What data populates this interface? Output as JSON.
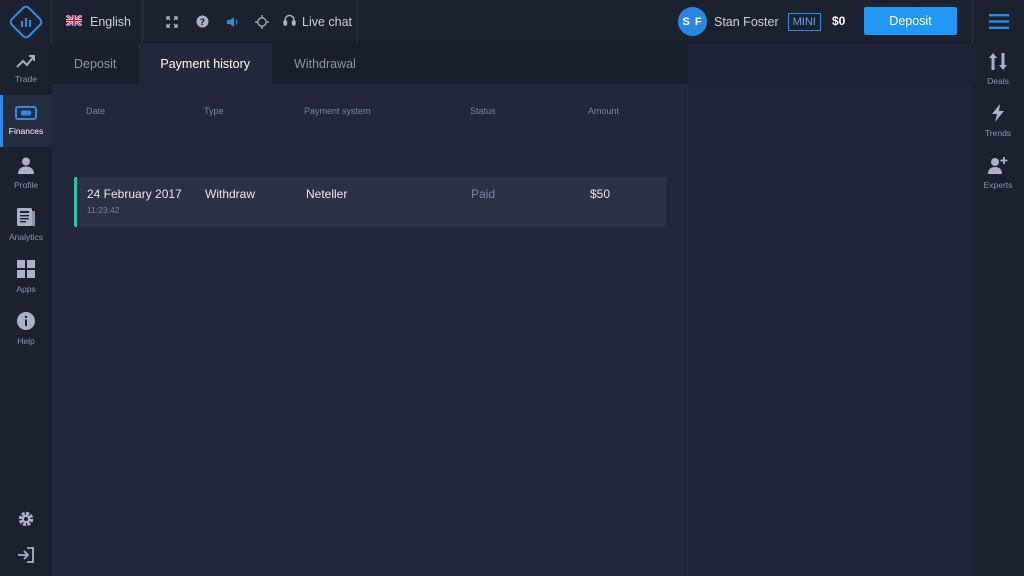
{
  "header": {
    "language": "English",
    "live_chat": "Live chat",
    "user": {
      "initials": "S F",
      "name": "Stan Foster",
      "tier": "MINI"
    },
    "balance": "$0",
    "deposit_label": "Deposit"
  },
  "left_nav": [
    {
      "label": "Trade",
      "icon": "trend-up-icon"
    },
    {
      "label": "Finances",
      "icon": "wallet-icon",
      "active": true
    },
    {
      "label": "Profile",
      "icon": "user-icon"
    },
    {
      "label": "Analytics",
      "icon": "news-icon"
    },
    {
      "label": "Apps",
      "icon": "grid-icon"
    },
    {
      "label": "Help",
      "icon": "info-icon"
    }
  ],
  "right_nav": [
    {
      "label": "Deals",
      "icon": "up-down-arrows-icon"
    },
    {
      "label": "Trends",
      "icon": "lightning-icon"
    },
    {
      "label": "Experts",
      "icon": "add-user-icon"
    }
  ],
  "tabs": [
    {
      "label": "Deposit"
    },
    {
      "label": "Payment history",
      "active": true
    },
    {
      "label": "Withdrawal"
    }
  ],
  "table": {
    "columns": [
      "Date",
      "Type",
      "Payment system",
      "Status",
      "Amount"
    ],
    "rows": [
      {
        "date": "24 February 2017",
        "time": "11:23:42",
        "type": "Withdraw",
        "system": "Neteller",
        "status": "Paid",
        "amount": "$50"
      }
    ]
  },
  "colors": {
    "accent": "#2196f3",
    "row_marker": "#2ec4a0",
    "background": "#1d2333"
  }
}
